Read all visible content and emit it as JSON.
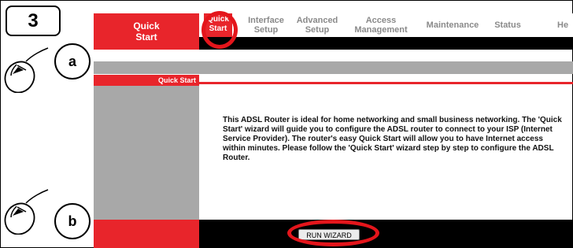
{
  "step": {
    "number": "3"
  },
  "callouts": {
    "a": "a",
    "b": "b"
  },
  "brand": {
    "line1": "Quick",
    "line2": "Start"
  },
  "nav": {
    "items": [
      {
        "line1": "Quick",
        "line2": "Start",
        "active": true
      },
      {
        "line1": "Interface",
        "line2": "Setup"
      },
      {
        "line1": "Advanced",
        "line2": "Setup"
      },
      {
        "line1": "Access",
        "line2": "Management"
      },
      {
        "line1": "Maintenance",
        "line2": ""
      },
      {
        "line1": "Status",
        "line2": ""
      },
      {
        "line1": "He",
        "line2": ""
      }
    ]
  },
  "sidebar": {
    "title": "Quick Start"
  },
  "content": {
    "text": "This ADSL Router is ideal for home networking and small business networking. The 'Quick Start' wizard will guide you to configure the ADSL router to connect to your ISP (Internet Service Provider). The router's easy Quick Start will allow you to have Internet access within minutes. Please follow the 'Quick Start' wizard step by step to configure the ADSL Router."
  },
  "actions": {
    "run_wizard": "RUN WIZARD"
  },
  "colors": {
    "brand_red": "#e8252b",
    "highlight_red": "#e4151b",
    "nav_gray": "#8a8a8a",
    "panel_gray": "#a8a8a8"
  }
}
